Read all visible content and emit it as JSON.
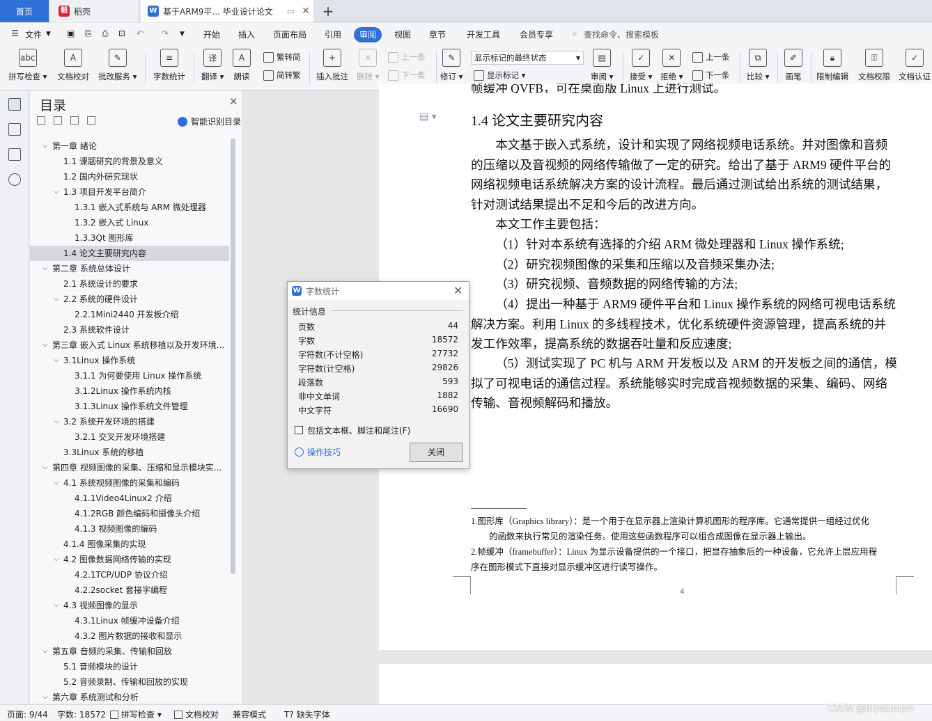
{
  "tabs": {
    "home": "首页",
    "daoke": "稻壳",
    "doc": "基于ARM9平... 毕业设计论文"
  },
  "menu": {
    "file": "文件",
    "items": [
      "开始",
      "插入",
      "页面布局",
      "引用",
      "审阅",
      "视图",
      "章节",
      "开发工具",
      "会员专享"
    ],
    "search": "查找命令、搜索模板"
  },
  "ribbon": {
    "spell": "拼写检查",
    "proof": "文档校对",
    "annotate_service": "批改服务",
    "wordcount": "字数统计",
    "translate": "翻译",
    "read": "朗读",
    "trad": "繁转简",
    "simp": "简转繁",
    "insert_comment": "插入批注",
    "delete": "删除",
    "prev": "上一条",
    "next": "下一条",
    "revise": "修订",
    "track_state": "显示标记的最终状态",
    "show_marks": "显示标记",
    "review": "审阅",
    "accept": "接受",
    "reject": "拒绝",
    "prev2": "上一条",
    "next2": "下一条",
    "compare": "比较",
    "pen": "画笔",
    "restrict": "限制编辑",
    "rights": "文档权限",
    "cert": "文档认证"
  },
  "toc": {
    "title": "目录",
    "smart": "智能识别目录",
    "items": [
      {
        "label": "第一章  绪论",
        "level": 0,
        "arrow": true
      },
      {
        "label": "1.1 课题研究的背景及意义",
        "level": 1
      },
      {
        "label": "1.2 国内外研究现状",
        "level": 1
      },
      {
        "label": "1.3 项目开发平台简介",
        "level": 1,
        "arrow": true
      },
      {
        "label": "1.3.1 嵌入式系统与 ARM 微处理器",
        "level": 2
      },
      {
        "label": "1.3.2 嵌入式 Linux",
        "level": 2
      },
      {
        "label": "1.3.3Qt 图形库",
        "level": 2
      },
      {
        "label": "1.4 论文主要研究内容",
        "level": 1,
        "selected": true
      },
      {
        "label": "第二章  系统总体设计",
        "level": 0,
        "arrow": true
      },
      {
        "label": "2.1 系统设计的要求",
        "level": 1
      },
      {
        "label": "2.2 系统的硬件设计",
        "level": 1,
        "arrow": true
      },
      {
        "label": "2.2.1Mini2440 开发板介绍",
        "level": 2
      },
      {
        "label": "2.3  系统软件设计",
        "level": 1
      },
      {
        "label": "第三章  嵌入式 Linux 系统移植以及开发环境...",
        "level": 0,
        "arrow": true
      },
      {
        "label": "3.1Linux 操作系统",
        "level": 1,
        "arrow": true
      },
      {
        "label": "3.1.1 为何要使用 Linux 操作系统",
        "level": 2
      },
      {
        "label": "3.1.2Linux 操作系统内核",
        "level": 2
      },
      {
        "label": "3.1.3Linux 操作系统文件管理",
        "level": 2
      },
      {
        "label": "3.2  系统开发环境的搭建",
        "level": 1,
        "arrow": true
      },
      {
        "label": "3.2.1 交叉开发环境搭建",
        "level": 2
      },
      {
        "label": "3.3Linux 系统的移植",
        "level": 1
      },
      {
        "label": "第四章  视频图像的采集、压缩和显示模块实...",
        "level": 0,
        "arrow": true
      },
      {
        "label": "4.1 系统视频图像的采集和编码",
        "level": 1,
        "arrow": true
      },
      {
        "label": "4.1.1Video4Linux2 介绍",
        "level": 2
      },
      {
        "label": "4.1.2RGB 颜色编码和摄像头介绍",
        "level": 2
      },
      {
        "label": "4.1.3 视频图像的编码",
        "level": 2
      },
      {
        "label": "4.1.4 图像采集的实现",
        "level": 1
      },
      {
        "label": "4.2 图像数据网络传输的实现",
        "level": 1,
        "arrow": true
      },
      {
        "label": "4.2.1TCP/UDP 协议介绍",
        "level": 2
      },
      {
        "label": "4.2.2socket 套接字编程",
        "level": 2
      },
      {
        "label": "4.3 视频图像的显示",
        "level": 1,
        "arrow": true
      },
      {
        "label": "4.3.1Linux 帧缓冲设备介绍",
        "level": 2
      },
      {
        "label": "4.3.2 图片数据的接收和显示",
        "level": 2
      },
      {
        "label": "第五章  音频的采集、传输和回放",
        "level": 0,
        "arrow": true
      },
      {
        "label": "5.1 音频模块的设计",
        "level": 1
      },
      {
        "label": "5.2 音频录制、传输和回放的实现",
        "level": 1
      },
      {
        "label": "第六章  系统测试和分析",
        "level": 0,
        "arrow": true
      }
    ]
  },
  "document": {
    "cut_line": "帧缓冲 QVFB，可在桌面版 Linux 上进行测试。",
    "section_title": "1.4 论文主要研究内容",
    "para1": "本文基于嵌入式系统，设计和实现了网络视频电话系统。并对图像和音频的压缩以及音视频的网络传输做了一定的研究。给出了基于 ARM9 硬件平台的网络视频电话系统解决方案的设计流程。最后通过测试给出系统的测试结果，针对测试结果提出不足和今后的改进方向。",
    "para2": "本文工作主要包括：",
    "item1": "（1）针对本系统有选择的介绍 ARM 微处理器和 Linux 操作系统;",
    "item2": "（2）研究视频图像的采集和压缩以及音频采集办法;",
    "item3": "（3）研究视频、音频数据的网络传输的方法;",
    "item4": "（4）提出一种基于 ARM9 硬件平台和 Linux 操作系统的网络可视电话系统解决方案。利用 Linux 的多线程技术，优化系统硬件资源管理，提高系统的并发工作效率，提高系统的数据吞吐量和反应速度;",
    "item5": "（5）测试实现了 PC 机与 ARM 开发板以及 ARM 的开发板之间的通信，模拟了可视电话的通信过程。系统能够实时完成音视频数据的采集、编码、网络传输、音视频解码和播放。",
    "fn1a": "1.图形库（Graphics library）：是一个用于在显示器上渲染计算机图形的程序库。它通常提供一组经过优化",
    "fn1b": "的函数来执行常见的渲染任务。使用这些函数程序可以组合成图像在显示器上输出。",
    "fn2a": "2.帧缓冲（framebuffer）：Linux 为显示设备提供的一个接口，把显存抽象后的一种设备，它允许上层应用程",
    "fn2b": "序在图形模式下直接对显示缓冲区进行读写操作。",
    "page_number": "4"
  },
  "dialog": {
    "title": "字数统计",
    "group": "统计信息",
    "stats": [
      {
        "label": "页数",
        "value": "44"
      },
      {
        "label": "字数",
        "value": "18572"
      },
      {
        "label": "字符数(不计空格)",
        "value": "27732"
      },
      {
        "label": "字符数(计空格)",
        "value": "29826"
      },
      {
        "label": "段落数",
        "value": "593"
      },
      {
        "label": "非中文单词",
        "value": "1882"
      },
      {
        "label": "中文字符",
        "value": "16690"
      }
    ],
    "checkbox": "包括文本框、脚注和尾注(F)",
    "tips": "操作技巧",
    "close": "关闭"
  },
  "status": {
    "page": "页面: 9/44",
    "words": "字数: 18572",
    "spell": "拼写检查",
    "proof": "文档校对",
    "compat": "兼容模式",
    "font": "缺失字体"
  },
  "watermark": "CSDN @biyezuopin",
  "colors": {
    "accent": "#2f6fd8",
    "wps_red": "#d7263d",
    "doc_blue": "#2f6fd8"
  }
}
